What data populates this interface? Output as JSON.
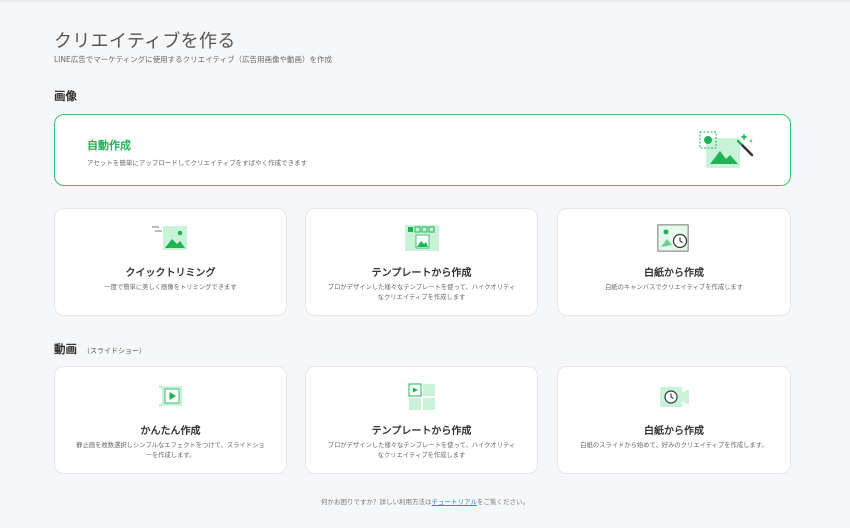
{
  "header": {
    "title": "クリエイティブを作る",
    "subtitle": "LINE広告でマーケティングに使用するクリエイティブ（広告用画像や動画）を作成"
  },
  "image_section": {
    "label": "画像",
    "featured": {
      "title": "自動作成",
      "desc": "アセットを簡単にアップロードしてクリエイティブをすばやく作成できます",
      "icon": "auto-create-magic-wand-icon"
    },
    "cards": [
      {
        "title": "クイックトリミング",
        "desc": "一度で簡単に美しく画像をトリミングできます",
        "icon": "quick-trim-image-icon"
      },
      {
        "title": "テンプレートから作成",
        "desc": "プロがデザインした様々なテンプレートを使って、ハイクオリティなクリエイティブを作成します",
        "icon": "template-image-icon"
      },
      {
        "title": "白紙から作成",
        "desc": "白紙のキャンバスでクリエイティブを作成します",
        "icon": "blank-canvas-clock-icon"
      }
    ]
  },
  "video_section": {
    "label": "動画",
    "sublabel": "（スライドショー）",
    "cards": [
      {
        "title": "かんたん作成",
        "desc": "静止画を枚数選択しシンプルなエフェクトをつけて、スライドショーを作成します。",
        "icon": "easy-video-play-icon"
      },
      {
        "title": "テンプレートから作成",
        "desc": "プロがデザインした様々なテンプレートを使って、ハイクオリティなクリエイティブを作成します",
        "icon": "template-video-icon"
      },
      {
        "title": "白紙から作成",
        "desc": "白紙のスライドから始めて、好みのクリエイティブを作成します。",
        "icon": "blank-video-camera-icon"
      }
    ]
  },
  "footer": {
    "before": "何かお困りですか？詳しい利用方法は",
    "link": "チュートリアル",
    "after": "をご覧ください。"
  },
  "colors": {
    "accent": "#1fb356",
    "accent_light": "#c9f2d8",
    "border": "#e4e6e9",
    "background": "#f6f7f9"
  }
}
